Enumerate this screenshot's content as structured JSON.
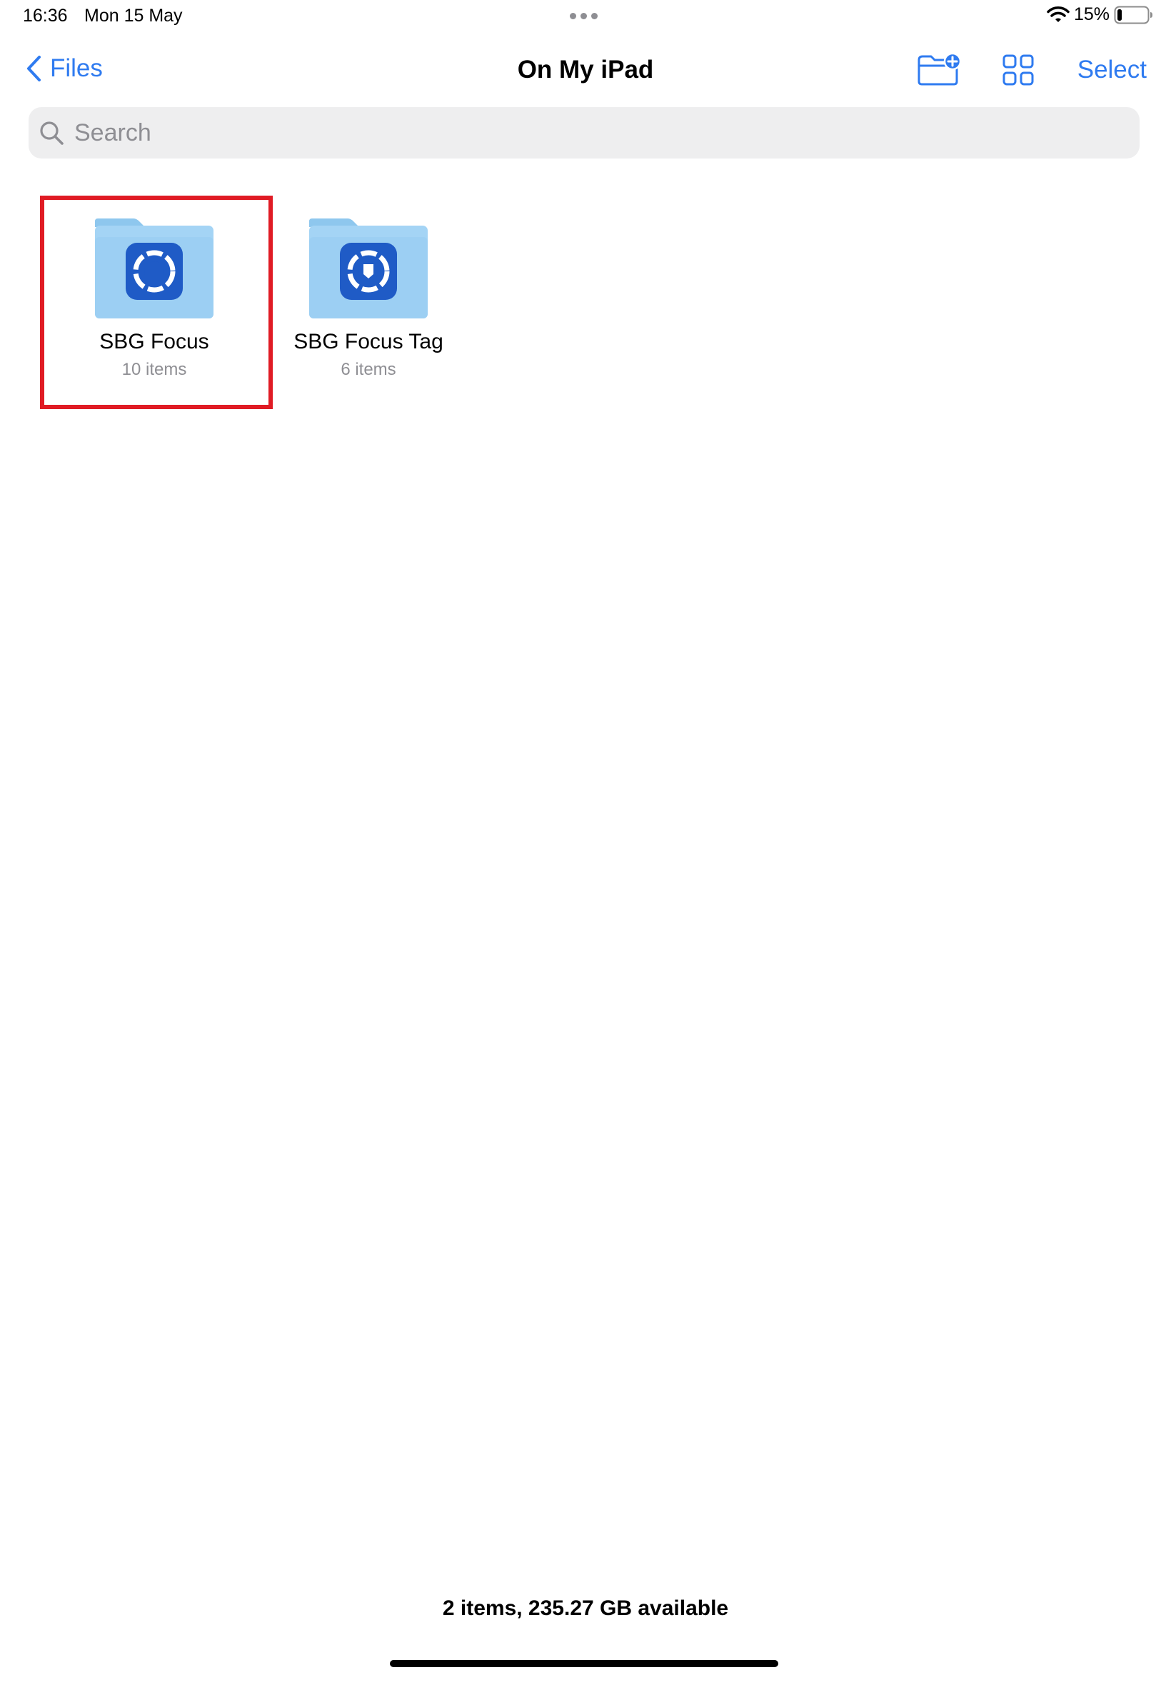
{
  "status_bar": {
    "time": "16:36",
    "date": "Mon 15 May",
    "battery_percent": "15%",
    "battery_level": 0.15,
    "icons": [
      "multitasking-dots-icon",
      "wifi-icon",
      "battery-icon"
    ]
  },
  "nav": {
    "back_label": "Files",
    "title": "On My iPad",
    "select_label": "Select",
    "icons": [
      "chevron-left-icon",
      "new-folder-icon",
      "grid-view-icon"
    ]
  },
  "search": {
    "placeholder": "Search",
    "value": ""
  },
  "folders": [
    {
      "name": "SBG Focus",
      "count": "10 items",
      "icon": "sbg-focus-app-icon",
      "highlighted": true
    },
    {
      "name": "SBG Focus Tag",
      "count": "6 items",
      "icon": "sbg-focus-tag-app-icon",
      "highlighted": false
    }
  ],
  "footer": {
    "status": "2 items, 235.27 GB available"
  },
  "colors": {
    "accent": "#2f7bf0",
    "folder_light": "#a4d4f5",
    "folder_tab": "#8ec7ee",
    "app_icon_blue": "#1f5bc6",
    "highlight": "#e01b24",
    "secondary_text": "#8e8e93",
    "search_bg": "#eeeeef"
  }
}
